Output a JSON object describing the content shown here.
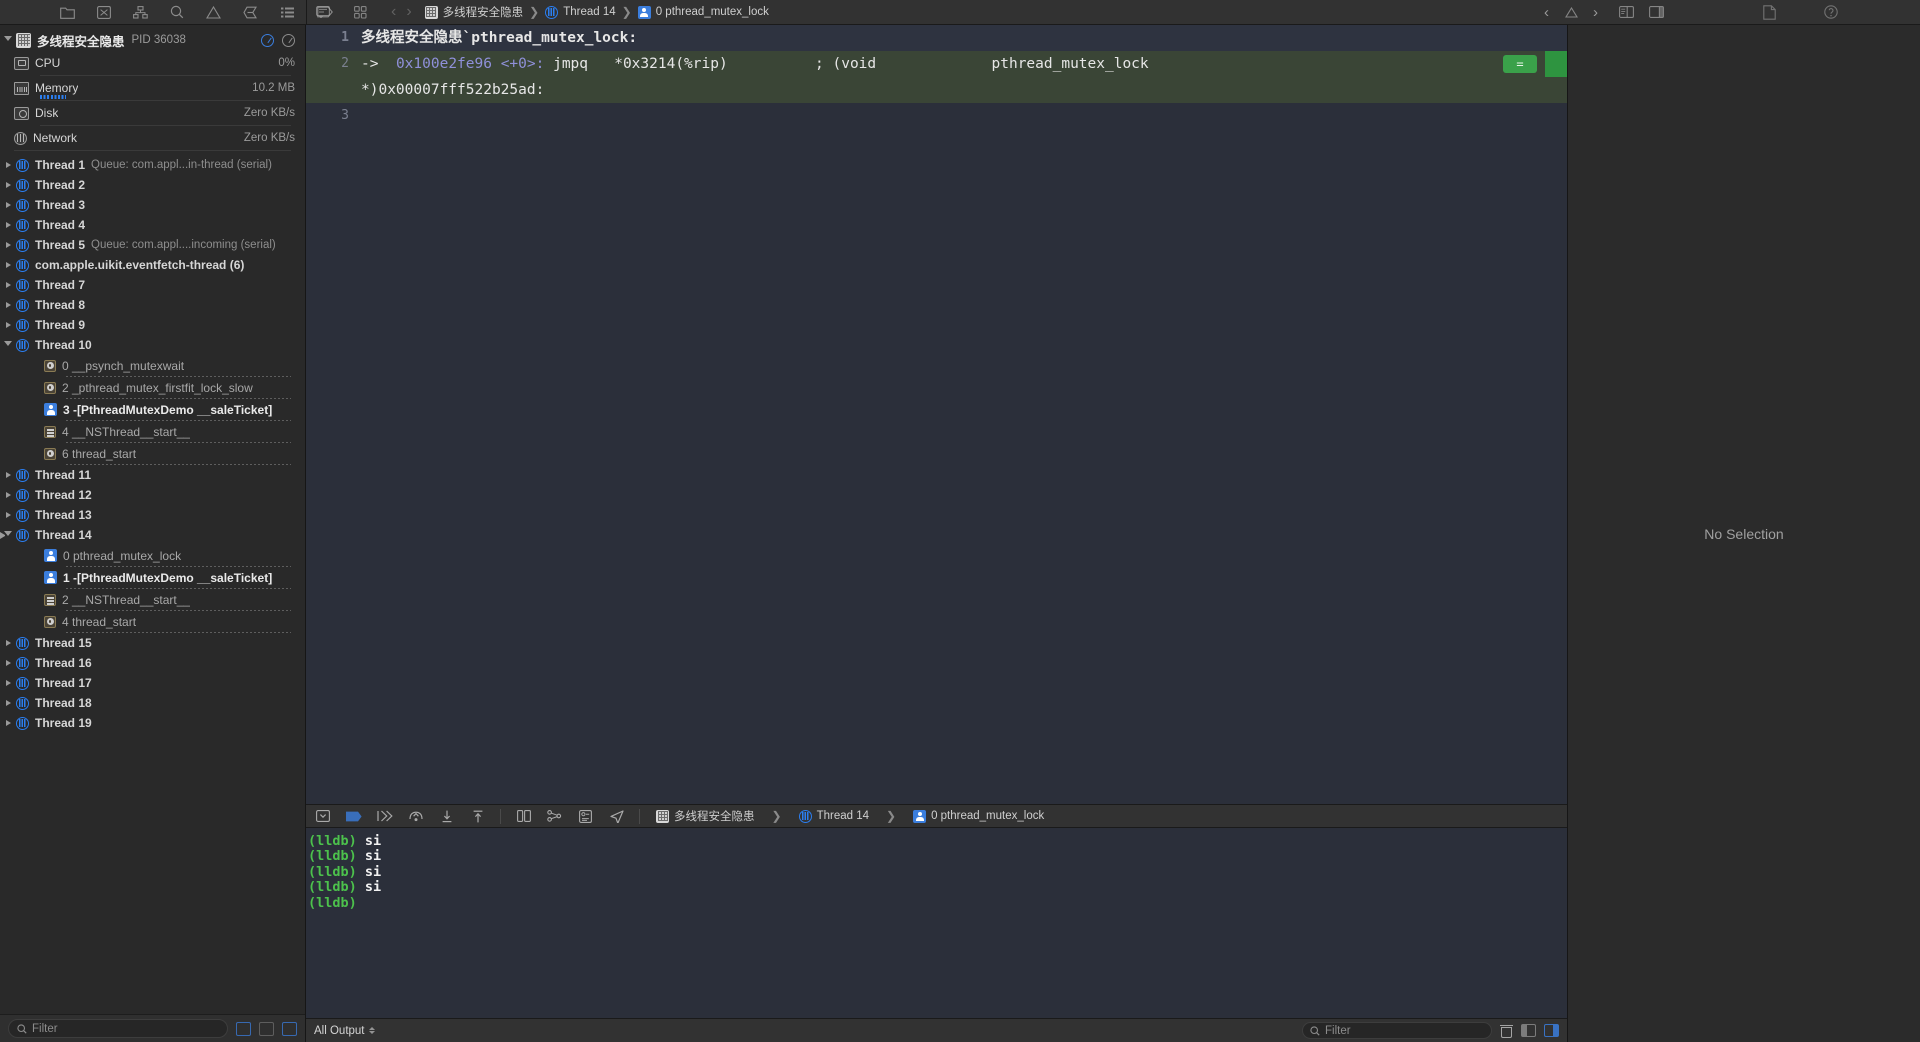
{
  "toolbar": {
    "left_icons": [
      "folder-icon",
      "issue-navigator-icon",
      "hierarchy-icon",
      "search-icon",
      "warning-icon",
      "breakpoint-icon",
      "report-icon",
      "tag-icon"
    ],
    "breadcrumb": [
      {
        "icon": "project-icon",
        "label": "多线程安全隐患"
      },
      {
        "icon": "thread-icon",
        "label": "Thread 14"
      },
      {
        "icon": "person-icon",
        "label": "0 pthread_mutex_lock"
      }
    ],
    "nav_back": "‹",
    "nav_forward": "›",
    "right_icons": [
      "chevron-left-icon",
      "warning-triangle-icon",
      "chevron-right-icon",
      "assistant-editor-icon",
      "editor-options-icon"
    ],
    "inspector_icons": [
      "file-inspector-icon",
      "quick-help-icon"
    ]
  },
  "navigator": {
    "process": {
      "name": "多线程安全隐患",
      "pid_label": "PID 36038",
      "badges": [
        "gauge-badge-blue",
        "gauge-badge-gray"
      ]
    },
    "gauges": [
      {
        "name": "CPU",
        "icon": "cpu-icon",
        "value": "0%",
        "bar": false
      },
      {
        "name": "Memory",
        "icon": "memory-icon",
        "value": "10.2 MB",
        "bar": true
      },
      {
        "name": "Disk",
        "icon": "disk-icon",
        "value": "Zero KB/s",
        "bar": false
      },
      {
        "name": "Network",
        "icon": "network-icon",
        "value": "Zero KB/s",
        "bar": false
      }
    ],
    "threads": [
      {
        "label": "Thread 1",
        "queue": "Queue: com.appl...in-thread (serial)",
        "expanded": false,
        "frames": []
      },
      {
        "label": "Thread 2",
        "queue": "",
        "expanded": false,
        "frames": []
      },
      {
        "label": "Thread 3",
        "queue": "",
        "expanded": false,
        "frames": []
      },
      {
        "label": "Thread 4",
        "queue": "",
        "expanded": false,
        "frames": []
      },
      {
        "label": "Thread 5",
        "queue": "Queue: com.appl....incoming (serial)",
        "expanded": false,
        "frames": []
      },
      {
        "label": "com.apple.uikit.eventfetch-thread (6)",
        "queue": "",
        "expanded": false,
        "frames": []
      },
      {
        "label": "Thread 7",
        "queue": "",
        "expanded": false,
        "frames": []
      },
      {
        "label": "Thread 8",
        "queue": "",
        "expanded": false,
        "frames": []
      },
      {
        "label": "Thread 9",
        "queue": "",
        "expanded": false,
        "frames": []
      },
      {
        "label": "Thread 10",
        "queue": "",
        "expanded": true,
        "frames": [
          {
            "label": "0 __psynch_mutexwait",
            "icon": "gear-icon",
            "kind": "sys"
          },
          {
            "label": "2 _pthread_mutex_firstfit_lock_slow",
            "icon": "gear-icon",
            "kind": "sys"
          },
          {
            "label": "3 -[PthreadMutexDemo __saleTicket]",
            "icon": "person-icon",
            "kind": "user"
          },
          {
            "label": "4 __NSThread__start__",
            "icon": "list-icon",
            "kind": "sys"
          },
          {
            "label": "6 thread_start",
            "icon": "gear-icon",
            "kind": "sys"
          }
        ]
      },
      {
        "label": "Thread 11",
        "queue": "",
        "expanded": false,
        "frames": []
      },
      {
        "label": "Thread 12",
        "queue": "",
        "expanded": false,
        "frames": []
      },
      {
        "label": "Thread 13",
        "queue": "",
        "expanded": false,
        "frames": []
      },
      {
        "label": "Thread 14",
        "queue": "",
        "expanded": true,
        "selected": true,
        "frames": [
          {
            "label": "0 pthread_mutex_lock",
            "icon": "person-icon",
            "kind": "sys"
          },
          {
            "label": "1 -[PthreadMutexDemo __saleTicket]",
            "icon": "person-icon",
            "kind": "user"
          },
          {
            "label": "2 __NSThread__start__",
            "icon": "list-icon",
            "kind": "sys"
          },
          {
            "label": "4 thread_start",
            "icon": "gear-icon",
            "kind": "sys"
          }
        ]
      },
      {
        "label": "Thread 15",
        "queue": "",
        "expanded": false,
        "frames": []
      },
      {
        "label": "Thread 16",
        "queue": "",
        "expanded": false,
        "frames": []
      },
      {
        "label": "Thread 17",
        "queue": "",
        "expanded": false,
        "frames": []
      },
      {
        "label": "Thread 18",
        "queue": "",
        "expanded": false,
        "frames": []
      },
      {
        "label": "Thread 19",
        "queue": "",
        "expanded": false,
        "frames": []
      }
    ],
    "filter": {
      "placeholder": "Filter",
      "icon": "search-icon",
      "buttons": [
        "show-only-crashed-icon",
        "show-only-recent-icon",
        "stack-compression-icon"
      ]
    }
  },
  "editor": {
    "lines": [
      {
        "no": "1",
        "kind": "header",
        "text": "多线程安全隐患`pthread_mutex_lock:"
      },
      {
        "no": "2",
        "kind": "current",
        "arrow": "->",
        "address": "0x100e2fe96",
        "offset": "<+0>:",
        "mnemonic": "jmpq",
        "operand": "*0x3214(%rip)",
        "comment": "; (void *)0x00007fff522b25ad:",
        "continuation": "pthread_mutex_lock",
        "badge": "="
      },
      {
        "no": "3",
        "kind": "blank",
        "text": ""
      }
    ]
  },
  "debug_bar": {
    "icons": [
      "hide-debug-area-icon",
      "breakpoint-toggle-icon",
      "continue-icon",
      "step-over-icon",
      "step-into-icon",
      "step-out-icon",
      "debug-view-hierarchy-icon",
      "memory-graph-icon",
      "environment-overrides-icon",
      "location-icon"
    ],
    "breadcrumb": [
      {
        "icon": "project-icon",
        "label": "多线程安全隐患"
      },
      {
        "icon": "thread-icon",
        "label": "Thread 14"
      },
      {
        "icon": "person-icon",
        "label": "0 pthread_mutex_lock"
      }
    ]
  },
  "console": {
    "lines": [
      {
        "prompt": "(lldb)",
        "cmd": " si"
      },
      {
        "prompt": "(lldb)",
        "cmd": " si"
      },
      {
        "prompt": "(lldb)",
        "cmd": " si"
      },
      {
        "prompt": "(lldb)",
        "cmd": " si"
      },
      {
        "prompt": "(lldb)",
        "cmd": ""
      }
    ],
    "footer": {
      "output_selector": "All Output",
      "filter_placeholder": "Filter",
      "filter_icon": "search-icon",
      "buttons": [
        "clear-console-icon",
        "show-variables-view-icon",
        "show-console-view-icon"
      ]
    }
  },
  "inspector": {
    "empty_label": "No Selection"
  },
  "colors": {
    "accent": "#3b7edd",
    "current_line": "#3a4536",
    "green_badge": "#3aa14a",
    "editor_bg": "#2b2f3a",
    "prompt_green": "#4cc14c"
  }
}
